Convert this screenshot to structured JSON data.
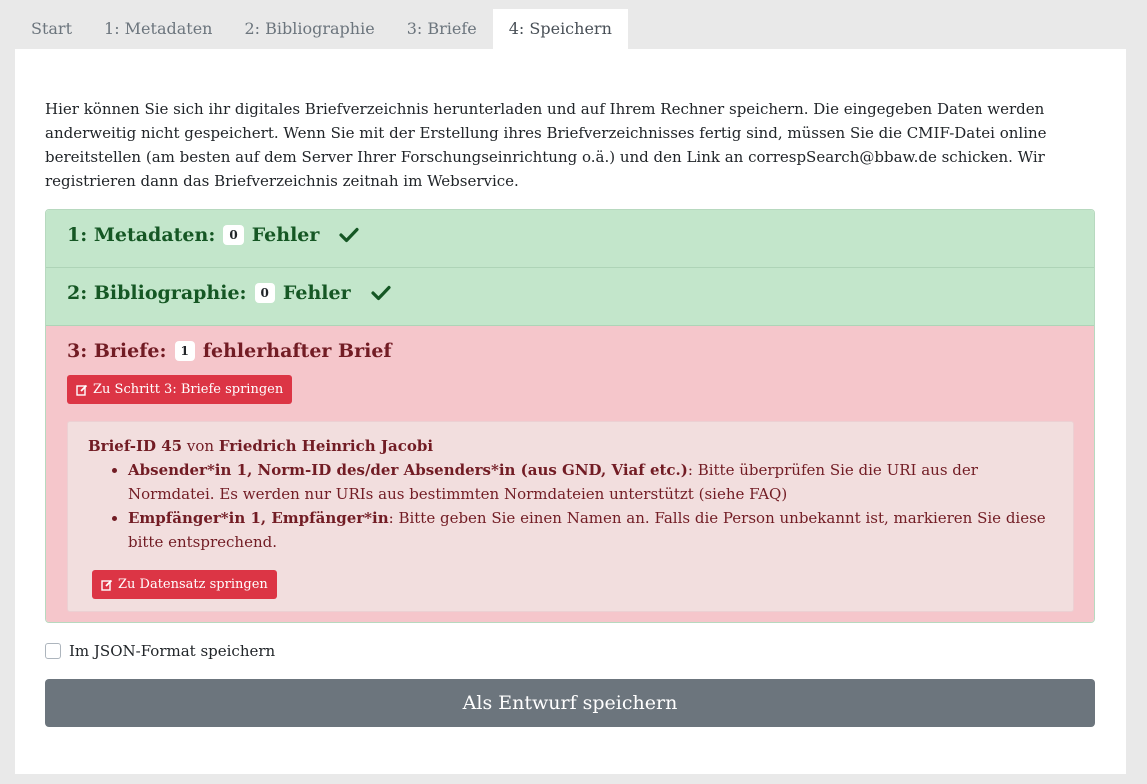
{
  "tabs": [
    {
      "label": "Start"
    },
    {
      "label": "1: Metadaten"
    },
    {
      "label": "2: Bibliographie"
    },
    {
      "label": "3: Briefe"
    },
    {
      "label": "4: Speichern"
    }
  ],
  "intro": "Hier können Sie sich ihr digitales Briefverzeichnis herunterladen und auf Ihrem Rechner speichern. Die eingegeben Daten werden anderweitig nicht gespeichert. Wenn Sie mit der Erstellung ihres Briefverzeichnisses fertig sind, müssen Sie die CMIF-Datei online bereitstellen (am besten auf dem Server Ihrer Forschungseinrichtung o.ä.) und den Link an correspSearch@bbaw.de schicken. Wir registrieren dann das Briefverzeichnis zeitnah im Webservice.",
  "metadaten": {
    "label": "1: Metadaten:",
    "count": "0",
    "suffix": "Fehler"
  },
  "bibliographie": {
    "label": "2: Bibliographie:",
    "count": "0",
    "suffix": "Fehler"
  },
  "briefe": {
    "label": "3: Briefe:",
    "count": "1",
    "suffix": "fehlerhafter Brief",
    "jump_label": "Zu Schritt 3: Briefe springen",
    "letter": {
      "id": "Brief-ID 45",
      "von": "von",
      "author": "Friedrich Heinrich Jacobi",
      "errors": [
        {
          "field": "Absender*in 1, Norm-ID des/der Absenders*in (aus GND, Viaf etc.)",
          "message": ": Bitte überprüfen Sie die URI aus der Normdatei. Es werden nur URIs aus bestimmten Normdateien unterstützt (siehe FAQ)"
        },
        {
          "field": "Empfänger*in 1, Empfänger*in",
          "message": ": Bitte geben Sie einen Namen an. Falls die Person unbekannt ist, markieren Sie diese bitte entsprechend."
        }
      ],
      "jump_label": "Zu Datensatz springen"
    }
  },
  "json_option": "Im JSON-Format speichern",
  "save_label": "Als Entwurf speichern",
  "colors": {
    "success": "#155724",
    "danger": "#dc3545",
    "secondary": "#6c757d"
  }
}
